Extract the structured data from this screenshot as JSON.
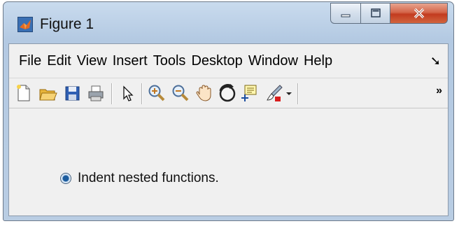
{
  "window": {
    "title": "Figure 1"
  },
  "menubar": {
    "items": [
      "File",
      "Edit",
      "View",
      "Insert",
      "Tools",
      "Desktop",
      "Window",
      "Help"
    ],
    "overflow_glyph": "➘"
  },
  "toolbar": {
    "overflow_glyph": "»"
  },
  "content": {
    "radio_label": "Indent nested functions.",
    "radio_selected": true
  },
  "colors": {
    "title_bar": "#b9cde3",
    "close_button": "#c94a2b",
    "client_bg": "#f0f0f0",
    "radio_dot": "#1c5c9e"
  }
}
